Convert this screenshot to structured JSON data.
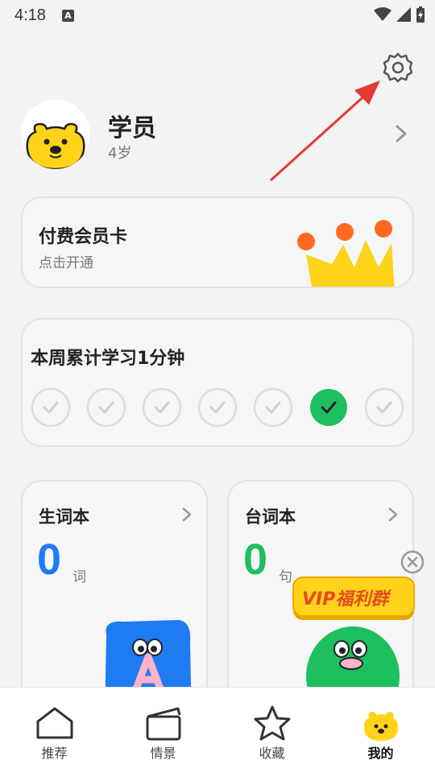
{
  "status": {
    "time": "4:18",
    "notif_badge": "A"
  },
  "profile": {
    "name": "学员",
    "age": "4岁",
    "avatar_icon": "bear-face-icon"
  },
  "vip_card": {
    "title": "付费会员卡",
    "subtitle": "点击开通",
    "illustration": "crown-icon"
  },
  "weekly": {
    "title": "本周累计学习1分钟",
    "days": [
      {
        "done": false
      },
      {
        "done": false
      },
      {
        "done": false
      },
      {
        "done": false
      },
      {
        "done": false
      },
      {
        "done": true
      },
      {
        "done": false
      }
    ],
    "active_color": "#1dbf5e"
  },
  "wordbook": {
    "title": "生词本",
    "count": "0",
    "unit": "词",
    "count_color": "#1f7bf2"
  },
  "phrasebook": {
    "title": "台词本",
    "count": "0",
    "unit": "句",
    "count_color": "#1dbf5e"
  },
  "promo": {
    "label": "VIP福利群"
  },
  "nav": {
    "items": [
      {
        "label": "推荐",
        "icon": "house-icon"
      },
      {
        "label": "情景",
        "icon": "clapperboard-icon"
      },
      {
        "label": "收藏",
        "icon": "star-icon"
      },
      {
        "label": "我的",
        "icon": "bear-face-icon",
        "active": true
      }
    ]
  },
  "colors": {
    "accent_yellow": "#ffd31a",
    "annotation_red": "#e53935"
  }
}
